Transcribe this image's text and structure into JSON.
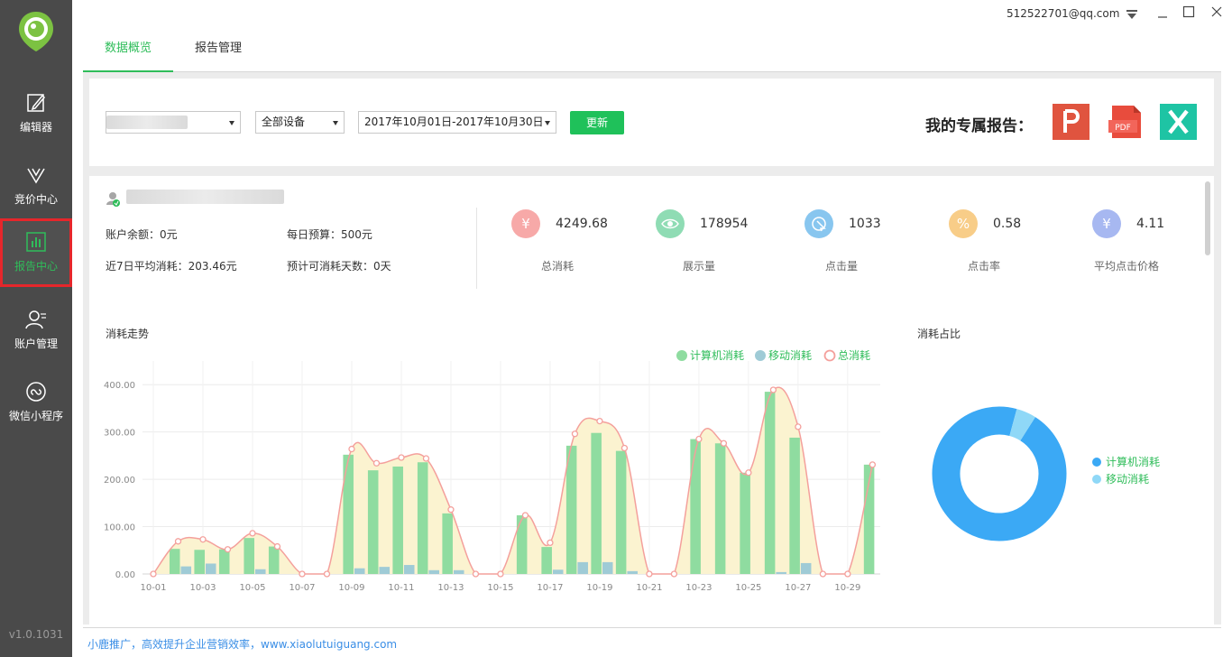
{
  "sidebar": {
    "items": [
      {
        "label": "编辑器",
        "icon": "edit-icon"
      },
      {
        "label": "竞价中心",
        "icon": "bidding-icon"
      },
      {
        "label": "报告中心",
        "icon": "report-chart-icon",
        "active": true
      },
      {
        "label": "账户管理",
        "icon": "user-manage-icon"
      },
      {
        "label": "微信小程序",
        "icon": "mini-program-icon"
      }
    ],
    "version": "v1.0.1031"
  },
  "header": {
    "email": "512522701@qq.com"
  },
  "tabs": [
    {
      "label": "数据概览",
      "active": true
    },
    {
      "label": "报告管理",
      "active": false
    }
  ],
  "filters": {
    "device_select": "全部设备",
    "date_range": "2017年10月01日-2017年10月30日",
    "update_button": "更新",
    "report_title": "我的专属报告："
  },
  "account": {
    "balance": "账户余额：0元",
    "daily_budget": "每日预算：500元",
    "avg_cost_7d": "近7日平均消耗：203.46元",
    "days_left": "预计可消耗天数：0天"
  },
  "kpis": [
    {
      "icon": "yen-icon",
      "symbol": "¥",
      "value": "4249.68",
      "label": "总消耗",
      "color": "#f7a9a8"
    },
    {
      "icon": "eye-icon",
      "symbol": "",
      "value": "178954",
      "label": "展示量",
      "color": "#8fdcb4"
    },
    {
      "icon": "cursor-click-icon",
      "symbol": "",
      "value": "1033",
      "label": "点击量",
      "color": "#88c6ef"
    },
    {
      "icon": "percent-icon",
      "symbol": "%",
      "value": "0.58",
      "label": "点击率",
      "color": "#f8cd88"
    },
    {
      "icon": "avg-price-icon",
      "symbol": "¥",
      "value": "4.11",
      "label": "平均点击价格",
      "color": "#a7b8f1"
    }
  ],
  "sections": {
    "trend_title": "消耗走势",
    "share_title": "消耗占比"
  },
  "colors": {
    "accent_green": "#2fbd5a",
    "pc_bar": "#8fdca0",
    "mobile_bar": "#9fcbd6",
    "total_line": "#f4a09c",
    "area_fill": "#fbf3d0",
    "donut_pc": "#3ba9f5",
    "donut_mobile": "#8fd8f7"
  },
  "chart_data": [
    {
      "type": "bar",
      "title": "消耗走势",
      "categories": [
        "10-01",
        "10-02",
        "10-03",
        "10-04",
        "10-05",
        "10-06",
        "10-07",
        "10-08",
        "10-09",
        "10-10",
        "10-11",
        "10-12",
        "10-13",
        "10-14",
        "10-15",
        "10-16",
        "10-17",
        "10-18",
        "10-19",
        "10-20",
        "10-21",
        "10-22",
        "10-23",
        "10-24",
        "10-25",
        "10-26",
        "10-27",
        "10-28",
        "10-29",
        "10-30"
      ],
      "x_tick_labels": [
        "10-01",
        "10-03",
        "10-05",
        "10-07",
        "10-09",
        "10-11",
        "10-13",
        "10-15",
        "10-17",
        "10-19",
        "10-21",
        "10-23",
        "10-25",
        "10-27",
        "10-29"
      ],
      "y_tick_labels": [
        "0.00",
        "100.00",
        "200.00",
        "300.00",
        "400.00"
      ],
      "ylim": [
        0,
        450
      ],
      "series": [
        {
          "name": "计算机消耗",
          "values": [
            0,
            53,
            51,
            52,
            76,
            58,
            0,
            0,
            252,
            219,
            227,
            236,
            128,
            0,
            0,
            124,
            57,
            271,
            298,
            260,
            0,
            0,
            285,
            276,
            214,
            385,
            288,
            0,
            0,
            231
          ]
        },
        {
          "name": "移动消耗",
          "values": [
            0,
            16,
            22,
            0,
            10,
            0,
            0,
            0,
            12,
            15,
            19,
            8,
            8,
            0,
            0,
            0,
            9,
            25,
            25,
            6,
            0,
            0,
            0,
            0,
            0,
            4,
            23,
            0,
            0,
            0
          ]
        },
        {
          "name": "总消耗",
          "values": [
            0,
            69,
            73,
            52,
            86,
            58,
            0,
            0,
            264,
            234,
            246,
            244,
            136,
            0,
            0,
            124,
            66,
            296,
            323,
            266,
            0,
            0,
            285,
            276,
            214,
            389,
            311,
            0,
            0,
            231
          ]
        }
      ]
    },
    {
      "type": "pie",
      "title": "消耗占比",
      "categories": [
        "计算机消耗",
        "移动消耗"
      ],
      "values": [
        4046,
        204
      ]
    }
  ],
  "footer": {
    "text": "小鹿推广，高效提升企业营销效率，www.xiaolutuiguang.com"
  }
}
